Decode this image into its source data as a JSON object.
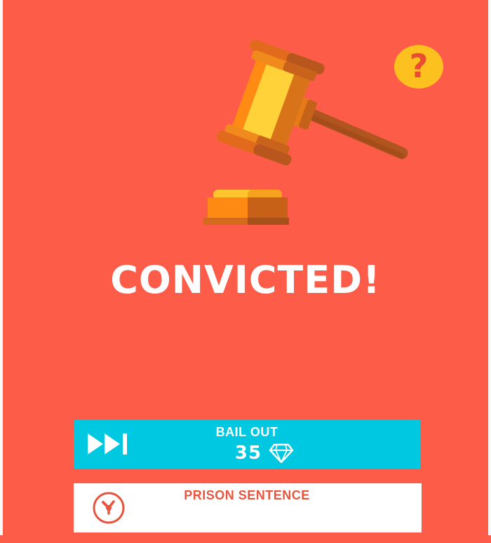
{
  "result": {
    "headline": "CONVICTED!"
  },
  "help": {
    "label": "?",
    "icon": "question-mark-icon"
  },
  "illustration": {
    "icon": "judge-gavel-icon"
  },
  "bail_out": {
    "label": "BAIL OUT",
    "cost": "35",
    "currency_icon": "diamond-icon",
    "action_icon": "fast-forward-icon"
  },
  "prison_sentence": {
    "label": "PRISON SENTENCE",
    "icon": "clock-icon"
  },
  "colors": {
    "background": "#fd5d48",
    "bail_button": "#00c8e0",
    "help_button": "#fdc11f",
    "prison_text": "#e6563f"
  }
}
